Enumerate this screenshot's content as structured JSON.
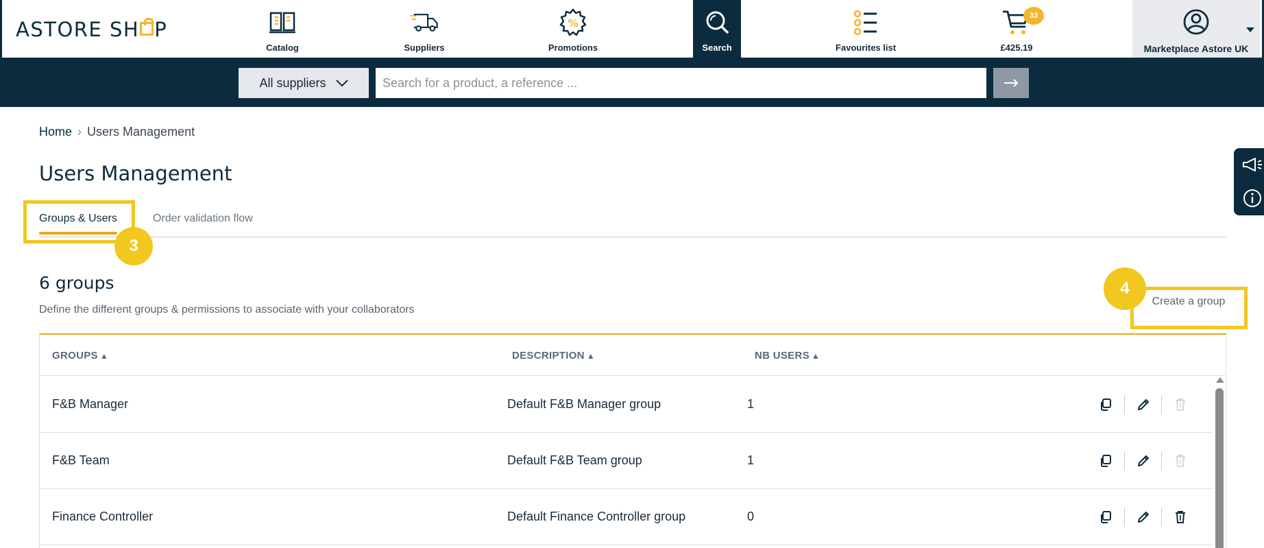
{
  "brand": {
    "logo_text_left": "ASTORE SH",
    "logo_text_right": "P"
  },
  "nav": {
    "items": [
      {
        "label": "Catalog",
        "icon": "catalog-icon"
      },
      {
        "label": "Suppliers",
        "icon": "truck-icon"
      },
      {
        "label": "Promotions",
        "icon": "promotion-badge-icon"
      },
      {
        "label": "Search",
        "icon": "search-icon",
        "active": true
      },
      {
        "label": "Favourites list",
        "icon": "list-icon"
      },
      {
        "label": "£425.19",
        "icon": "cart-icon",
        "badge": "33"
      }
    ],
    "account_label": "Marketplace Astore UK"
  },
  "search": {
    "supplier_select": "All suppliers",
    "placeholder": "Search for a product, a reference ...",
    "go_icon": "arrow-right-icon"
  },
  "breadcrumb": {
    "home": "Home",
    "separator": "›",
    "current": "Users Management"
  },
  "page_title": "Users Management",
  "tabs": [
    {
      "label": "Groups & Users",
      "active": true
    },
    {
      "label": "Order validation flow",
      "active": false
    }
  ],
  "annotations": {
    "step_3": "3",
    "step_4": "4"
  },
  "groups": {
    "title": "6 groups",
    "subtitle": "Define the different groups & permissions to associate with your collaborators",
    "create_label": "Create a group"
  },
  "table": {
    "headers": {
      "groups": "GROUPS",
      "description": "DESCRIPTION",
      "nb_users": "NB USERS",
      "sort_icon": "▲"
    },
    "rows": [
      {
        "group": "F&B Manager",
        "description": "Default F&B Manager group",
        "nb_users": "1",
        "delete_enabled": false
      },
      {
        "group": "F&B Team",
        "description": "Default F&B Team group",
        "nb_users": "1",
        "delete_enabled": false
      },
      {
        "group": "Finance Controller",
        "description": "Default Finance Controller group",
        "nb_users": "0",
        "delete_enabled": true
      }
    ]
  },
  "colors": {
    "navy": "#0d2b3e",
    "accent": "#f2b62b",
    "highlight": "#f2c71f",
    "tab_underline": "#e6a817"
  }
}
